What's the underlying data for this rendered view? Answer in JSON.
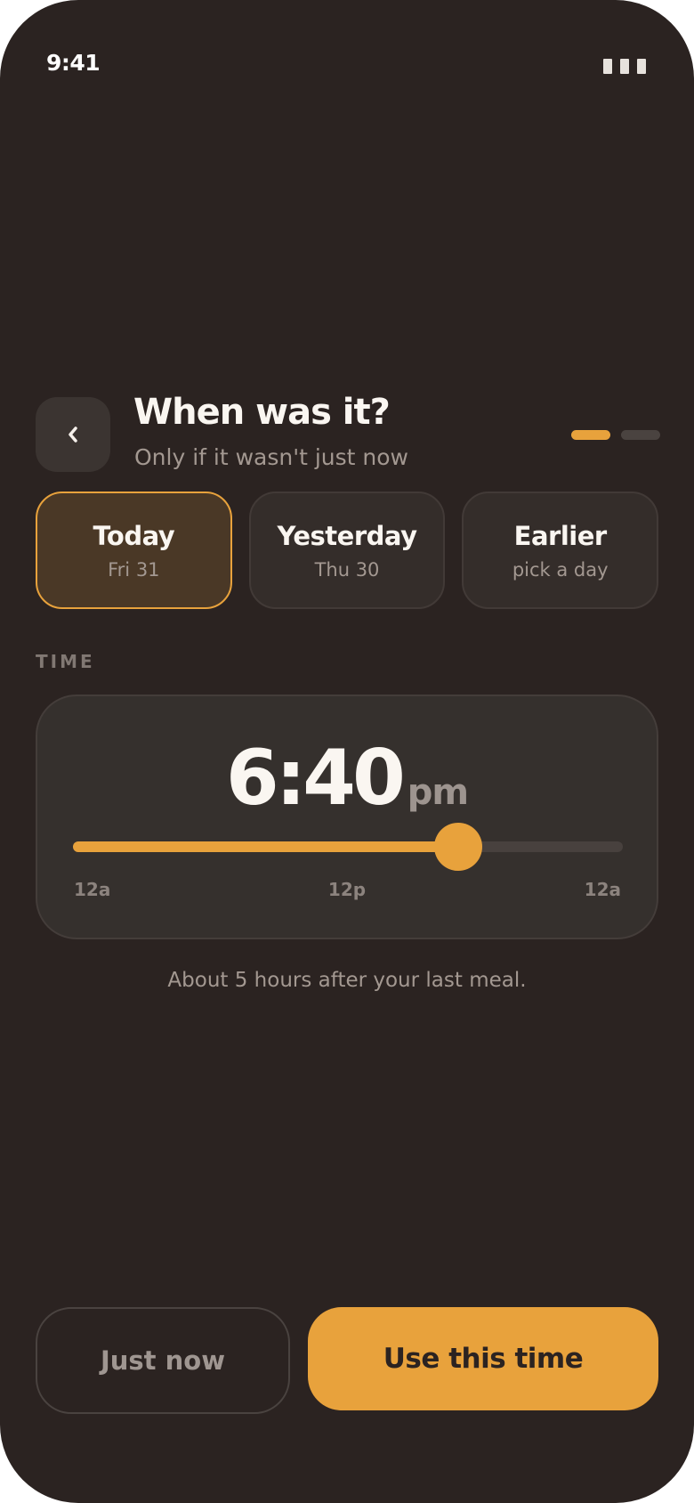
{
  "status_bar": {
    "time": "9:41",
    "battery_icon": "battery-icon"
  },
  "header": {
    "back_icon": "chevron-left-icon",
    "title": "When was it?",
    "subtitle": "Only if it wasn't just now",
    "steps": {
      "total": 2,
      "current": 1
    }
  },
  "days": [
    {
      "label": "Today",
      "sub": "Fri 31",
      "selected": true
    },
    {
      "label": "Yesterday",
      "sub": "Thu 30",
      "selected": false
    },
    {
      "label": "Earlier",
      "sub": "pick a day",
      "selected": false
    }
  ],
  "time_section": {
    "label": "TIME",
    "value": "6:40",
    "ampm": "pm",
    "slider_fraction": 0.7,
    "ticks": [
      "12a",
      "12p",
      "12a"
    ]
  },
  "hint": "About 5 hours after your last meal.",
  "actions": {
    "secondary": "Just now",
    "primary": "Use this time"
  },
  "colors": {
    "background": "#2b2321",
    "accent": "#e8a23c",
    "card": "#35302d",
    "selected_card": "#4a3826"
  }
}
